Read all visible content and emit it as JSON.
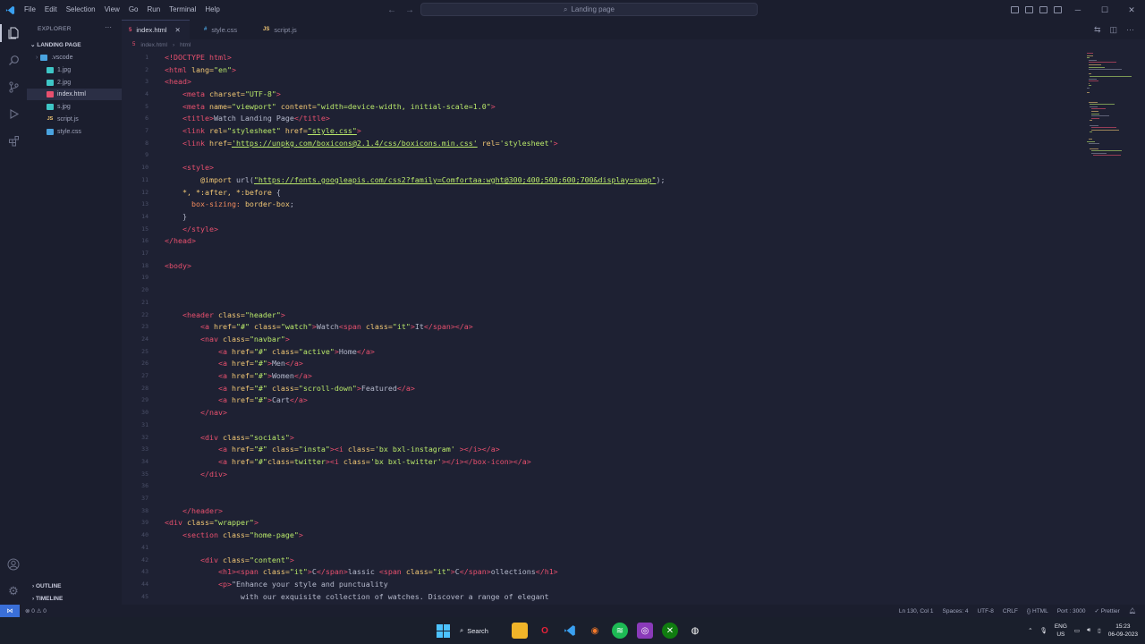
{
  "titlebar": {
    "menu": [
      "File",
      "Edit",
      "Selection",
      "View",
      "Go",
      "Run",
      "Terminal",
      "Help"
    ],
    "search_placeholder": "Landing page"
  },
  "sidebar": {
    "title": "EXPLORER",
    "folder": "LANDING PAGE",
    "files": [
      {
        "name": ".vscode",
        "icon": "folder",
        "color": "#4aa3df"
      },
      {
        "name": "1.jpg",
        "icon": "image",
        "color": "#3ec6c6"
      },
      {
        "name": "2.jpg",
        "icon": "image",
        "color": "#3ec6c6"
      },
      {
        "name": "index.html",
        "icon": "html",
        "color": "#e8506e"
      },
      {
        "name": "s.jpg",
        "icon": "image",
        "color": "#3ec6c6"
      },
      {
        "name": "script.js",
        "icon": "js",
        "color": "#f0c674"
      },
      {
        "name": "style.css",
        "icon": "css",
        "color": "#4aa3df"
      }
    ],
    "outline": "OUTLINE",
    "timeline": "TIMELINE"
  },
  "tabs": [
    {
      "label": "index.html",
      "icon_text": "5",
      "color": "#e8506e",
      "active": true
    },
    {
      "label": "style.css",
      "icon_text": "#",
      "color": "#4aa3df",
      "active": false
    },
    {
      "label": "script.js",
      "icon_text": "JS",
      "color": "#f0c674",
      "active": false
    }
  ],
  "breadcrumb": [
    "index.html",
    "html"
  ],
  "code_lines": [
    {
      "n": "1",
      "html": "<span class='t-tag'>&lt;!DOCTYPE html&gt;</span>"
    },
    {
      "n": "2",
      "html": "<span class='t-tag'>&lt;html</span> <span class='t-attr'>lang=</span><span class='t-str'>\"en\"</span><span class='t-tag'>&gt;</span>"
    },
    {
      "n": "3",
      "html": "<span class='t-tag'>&lt;head&gt;</span>"
    },
    {
      "n": "4",
      "html": "    <span class='t-tag'>&lt;meta</span> <span class='t-attr'>charset=</span><span class='t-str'>\"UTF-8\"</span><span class='t-tag'>&gt;</span>"
    },
    {
      "n": "5",
      "html": "    <span class='t-tag'>&lt;meta</span> <span class='t-attr'>name=</span><span class='t-str'>\"viewport\"</span> <span class='t-attr'>content=</span><span class='t-str'>\"width=device-width, initial-scale=1.0\"</span><span class='t-tag'>&gt;</span>"
    },
    {
      "n": "6",
      "html": "    <span class='t-tag'>&lt;title&gt;</span><span class='t-txt'>Watch Landing Page</span><span class='t-tag'>&lt;/title&gt;</span>"
    },
    {
      "n": "7",
      "html": "    <span class='t-tag'>&lt;link</span> <span class='t-attr'>rel=</span><span class='t-str'>\"stylesheet\"</span> <span class='t-attr'>href=</span><span class='t-url'>\"style.css\"</span><span class='t-tag'>&gt;</span>"
    },
    {
      "n": "8",
      "html": "    <span class='t-tag'>&lt;link</span> <span class='t-attr'>href=</span><span class='t-url'>'https://unpkg.com/boxicons@2.1.4/css/boxicons.min.css'</span> <span class='t-attr'>rel=</span><span class='t-str'>'stylesheet'</span><span class='t-tag'>&gt;</span>"
    },
    {
      "n": "9",
      "html": ""
    },
    {
      "n": "10",
      "html": "    <span class='t-tag'>&lt;style&gt;</span>"
    },
    {
      "n": "11",
      "html": "        <span class='t-attr'>@import</span> <span class='t-txt'>url(</span><span class='t-url'>\"https://fonts.googleapis.com/css2?family=Comfortaa:wght@300;400;500;600;700&amp;display=swap\"</span><span class='t-txt'>);</span>"
    },
    {
      "n": "12",
      "html": "    <span class='t-attr'>*, *:after, *:before</span> <span class='t-txt'>{</span>"
    },
    {
      "n": "13",
      "html": "      <span class='t-prop'>box-sizing:</span> <span class='t-attr'>border-box</span><span class='t-txt'>;</span>"
    },
    {
      "n": "14",
      "html": "    <span class='t-txt'>}</span>"
    },
    {
      "n": "15",
      "html": "    <span class='t-tag'>&lt;/style&gt;</span>"
    },
    {
      "n": "16",
      "html": "<span class='t-tag'>&lt;/head&gt;</span>"
    },
    {
      "n": "17",
      "html": ""
    },
    {
      "n": "18",
      "html": "<span class='t-tag'>&lt;body&gt;</span>"
    },
    {
      "n": "19",
      "html": ""
    },
    {
      "n": "20",
      "html": ""
    },
    {
      "n": "21",
      "html": ""
    },
    {
      "n": "22",
      "html": "    <span class='t-tag'>&lt;header</span> <span class='t-attr'>class=</span><span class='t-str'>\"header\"</span><span class='t-tag'>&gt;</span>"
    },
    {
      "n": "23",
      "html": "        <span class='t-tag'>&lt;a</span> <span class='t-attr'>href=</span><span class='t-str'>\"#\"</span> <span class='t-attr'>class=</span><span class='t-str'>\"watch\"</span><span class='t-tag'>&gt;</span><span class='t-txt'>Watch</span><span class='t-tag'>&lt;span</span> <span class='t-attr'>class=</span><span class='t-str'>\"it\"</span><span class='t-tag'>&gt;</span><span class='t-txt'>It</span><span class='t-tag'>&lt;/span&gt;&lt;/a&gt;</span>"
    },
    {
      "n": "24",
      "html": "        <span class='t-tag'>&lt;nav</span> <span class='t-attr'>class=</span><span class='t-str'>\"navbar\"</span><span class='t-tag'>&gt;</span>"
    },
    {
      "n": "25",
      "html": "            <span class='t-tag'>&lt;a</span> <span class='t-attr'>href=</span><span class='t-str'>\"#\"</span> <span class='t-attr'>class=</span><span class='t-str'>\"active\"</span><span class='t-tag'>&gt;</span><span class='t-txt'>Home</span><span class='t-tag'>&lt;/a&gt;</span>"
    },
    {
      "n": "26",
      "html": "            <span class='t-tag'>&lt;a</span> <span class='t-attr'>href=</span><span class='t-str'>\"#\"</span><span class='t-tag'>&gt;</span><span class='t-txt'>Men</span><span class='t-tag'>&lt;/a&gt;</span>"
    },
    {
      "n": "27",
      "html": "            <span class='t-tag'>&lt;a</span> <span class='t-attr'>href=</span><span class='t-str'>\"#\"</span><span class='t-tag'>&gt;</span><span class='t-txt'>Women</span><span class='t-tag'>&lt;/a&gt;</span>"
    },
    {
      "n": "28",
      "html": "            <span class='t-tag'>&lt;a</span> <span class='t-attr'>href=</span><span class='t-str'>\"#\"</span> <span class='t-attr'>class=</span><span class='t-str'>\"scroll-down\"</span><span class='t-tag'>&gt;</span><span class='t-txt'>Featured</span><span class='t-tag'>&lt;/a&gt;</span>"
    },
    {
      "n": "29",
      "html": "            <span class='t-tag'>&lt;a</span> <span class='t-attr'>href=</span><span class='t-str'>\"#\"</span><span class='t-tag'>&gt;</span><span class='t-txt'>Cart</span><span class='t-tag'>&lt;/a&gt;</span>"
    },
    {
      "n": "30",
      "html": "        <span class='t-tag'>&lt;/nav&gt;</span>"
    },
    {
      "n": "31",
      "html": ""
    },
    {
      "n": "32",
      "html": "        <span class='t-tag'>&lt;div</span> <span class='t-attr'>class=</span><span class='t-str'>\"socials\"</span><span class='t-tag'>&gt;</span>"
    },
    {
      "n": "33",
      "html": "            <span class='t-tag'>&lt;a</span> <span class='t-attr'>href=</span><span class='t-str'>\"#\"</span> <span class='t-attr'>class=</span><span class='t-str'>\"insta\"</span><span class='t-tag'>&gt;&lt;i</span> <span class='t-attr'>class=</span><span class='t-str'>'bx bxl-instagram'</span> <span class='t-tag'>&gt;&lt;/i&gt;&lt;/a&gt;</span>"
    },
    {
      "n": "34",
      "html": "            <span class='t-tag'>&lt;a</span> <span class='t-attr'>href=</span><span class='t-str'>\"#\"</span><span class='t-attr'>class=</span><span class='t-str'>twitter</span><span class='t-tag'>&gt;&lt;i</span> <span class='t-attr'>class=</span><span class='t-str'>'bx bxl-twitter'</span><span class='t-tag'>&gt;&lt;/i&gt;&lt;/box-icon&gt;&lt;/a&gt;</span>"
    },
    {
      "n": "35",
      "html": "        <span class='t-tag'>&lt;/div&gt;</span>"
    },
    {
      "n": "36",
      "html": ""
    },
    {
      "n": "37",
      "html": ""
    },
    {
      "n": "38",
      "html": "    <span class='t-tag'>&lt;/header&gt;</span>"
    },
    {
      "n": "39",
      "html": "<span class='t-tag'>&lt;div</span> <span class='t-attr'>class=</span><span class='t-str'>\"wrapper\"</span><span class='t-tag'>&gt;</span>"
    },
    {
      "n": "40",
      "html": "    <span class='t-tag'>&lt;section</span> <span class='t-attr'>class=</span><span class='t-str'>\"home-page\"</span><span class='t-tag'>&gt;</span>"
    },
    {
      "n": "41",
      "html": ""
    },
    {
      "n": "42",
      "html": "        <span class='t-tag'>&lt;div</span> <span class='t-attr'>class=</span><span class='t-str'>\"content\"</span><span class='t-tag'>&gt;</span>"
    },
    {
      "n": "43",
      "html": "            <span class='t-tag'>&lt;h1&gt;&lt;span</span> <span class='t-attr'>class=</span><span class='t-str'>\"it\"</span><span class='t-tag'>&gt;</span><span class='t-txt'>C</span><span class='t-tag'>&lt;/span&gt;</span><span class='t-txt'>lassic </span><span class='t-tag'>&lt;span</span> <span class='t-attr'>class=</span><span class='t-str'>\"it\"</span><span class='t-tag'>&gt;</span><span class='t-txt'>C</span><span class='t-tag'>&lt;/span&gt;</span><span class='t-txt'>ollections</span><span class='t-tag'>&lt;/h1&gt;</span>"
    },
    {
      "n": "44",
      "html": "            <span class='t-tag'>&lt;p&gt;</span><span class='t-txt'>\"Enhance your style and punctuality</span>"
    },
    {
      "n": "45",
      "html": "                 <span class='t-txt'>with our exquisite collection of watches. Discover a range of elegant</span>"
    }
  ],
  "statusbar": {
    "problems": "⊗ 0 ⚠ 0",
    "position": "Ln 130, Col 1",
    "spaces": "Spaces: 4",
    "encoding": "UTF-8",
    "eol": "CRLF",
    "language": "{} HTML",
    "port": "Port : 3000",
    "formatter": "✓ Prettier"
  },
  "taskbar": {
    "search_label": "Search",
    "lang_top": "ENG",
    "lang_bottom": "US",
    "time": "15:23",
    "date": "06-09-2023"
  }
}
